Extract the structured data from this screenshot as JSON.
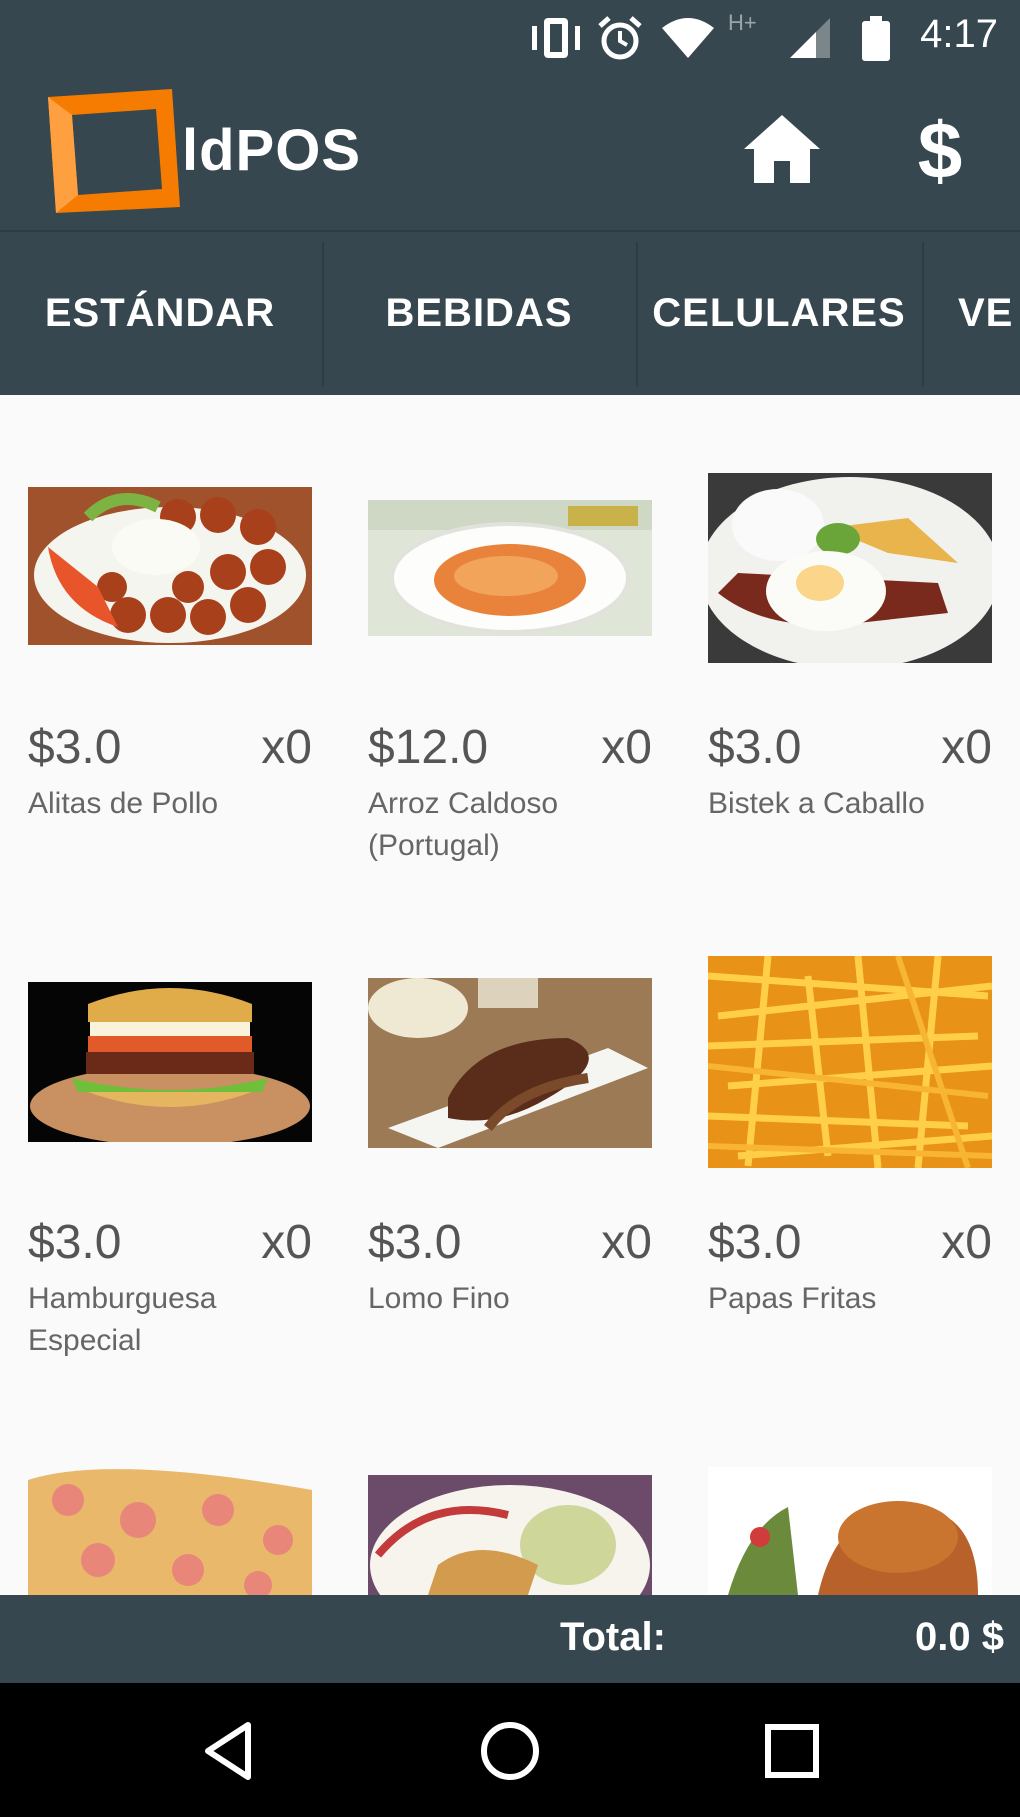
{
  "status_bar": {
    "time": "4:17",
    "network_label": "H+",
    "icons": [
      "vibrate-icon",
      "alarm-icon",
      "wifi-icon",
      "cell-signal-icon",
      "battery-icon"
    ]
  },
  "app_bar": {
    "title": "ldPOS",
    "home_icon": "home-icon",
    "dollar_label": "$"
  },
  "tabs": [
    {
      "label": "ESTÁNDAR"
    },
    {
      "label": "BEBIDAS"
    },
    {
      "label": "CELULARES"
    },
    {
      "label": "VE"
    }
  ],
  "products": [
    {
      "price": "$3.0",
      "qty": "x0",
      "name": "Alitas de Pollo"
    },
    {
      "price": "$12.0",
      "qty": "x0",
      "name": "Arroz Caldoso (Portugal)"
    },
    {
      "price": "$3.0",
      "qty": "x0",
      "name": "Bistek a Caballo"
    },
    {
      "price": "$3.0",
      "qty": "x0",
      "name": "Hamburguesa Especial"
    },
    {
      "price": "$3.0",
      "qty": "x0",
      "name": "Lomo Fino"
    },
    {
      "price": "$3.0",
      "qty": "x0",
      "name": "Papas Fritas"
    }
  ],
  "total_bar": {
    "label": "Total:",
    "value": "0.0 $"
  },
  "colors": {
    "primary": "#37474f",
    "accent": "#f57c00",
    "background": "#fafafa"
  }
}
